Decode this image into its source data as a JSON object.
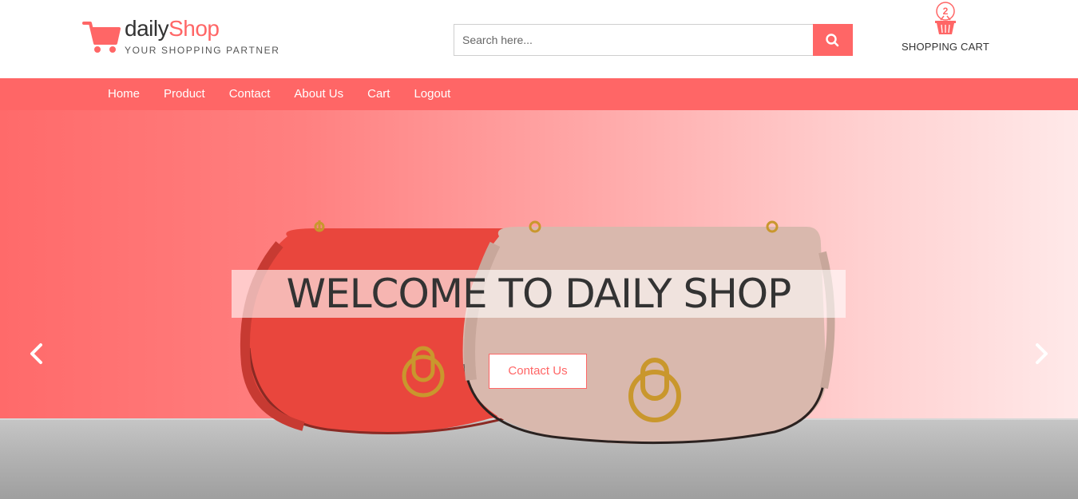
{
  "header": {
    "brand": {
      "part1": "daily",
      "part2": "Shop",
      "tagline": "YOUR SHOPPING PARTNER"
    },
    "search": {
      "placeholder": "Search here..."
    },
    "cart": {
      "count": "2",
      "label": "SHOPPING CART"
    }
  },
  "nav": {
    "items": [
      {
        "label": "Home"
      },
      {
        "label": "Product"
      },
      {
        "label": "Contact"
      },
      {
        "label": "About Us"
      },
      {
        "label": "Cart"
      },
      {
        "label": "Logout"
      }
    ]
  },
  "hero": {
    "title": "WELCOME TO DAILY SHOP",
    "button_label": "Contact Us"
  },
  "icons": {
    "logo": "shopping-cart-icon",
    "search": "search-icon",
    "cart": "basket-icon",
    "prev": "chevron-left-icon",
    "next": "chevron-right-icon"
  },
  "colors": {
    "accent": "#ff6666",
    "text_dark": "#333333",
    "white": "#ffffff"
  }
}
